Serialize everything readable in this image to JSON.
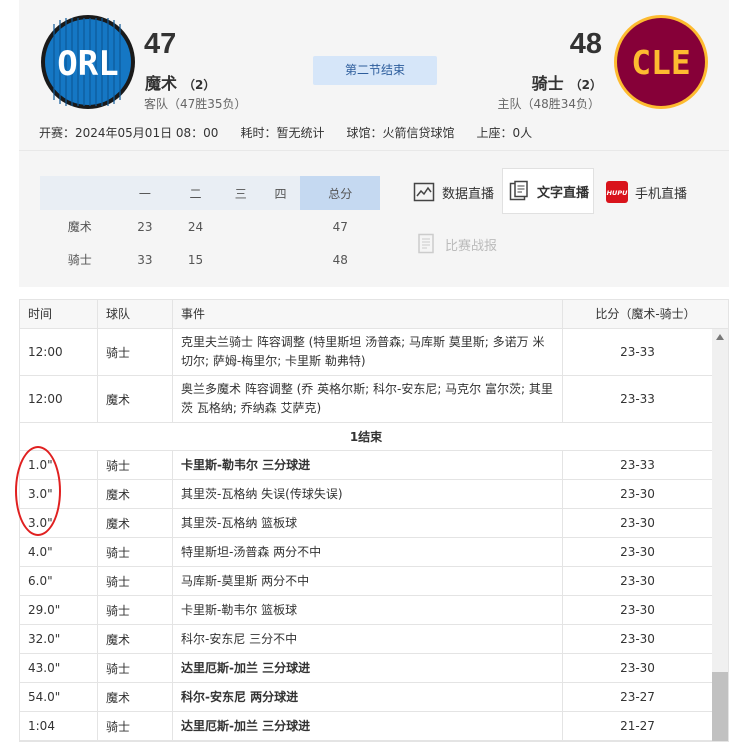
{
  "away": {
    "logo_text": "ORL",
    "score": "47",
    "name": "魔术",
    "rank": "（2）",
    "record": "客队（47胜35负）",
    "colors": {
      "primary": "#1577c4",
      "stripe": "#2f6db8",
      "ring": "#1a1a1a"
    }
  },
  "home": {
    "logo_text": "CLE",
    "score": "48",
    "name": "骑士",
    "rank": "（2）",
    "record": "主队（48胜34负）",
    "colors": {
      "primary": "#860038",
      "text": "#fdbb30",
      "ring": "#fdbb30"
    }
  },
  "status": "第二节结束",
  "info": {
    "start": "开赛：2024年05月01日  08：00",
    "duration": "耗时：暂无统计",
    "venue": "球馆：火箭信贷球馆",
    "attendance": "上座：0人"
  },
  "quarters": {
    "headers": [
      "",
      "一",
      "二",
      "三",
      "四",
      "总分"
    ],
    "rows": [
      {
        "team": "魔术",
        "q": [
          "23",
          "24",
          "",
          ""
        ],
        "total": "47"
      },
      {
        "team": "骑士",
        "q": [
          "33",
          "15",
          "",
          ""
        ],
        "total": "48"
      }
    ]
  },
  "live_buttons": {
    "data": "数据直播",
    "text": "文字直播",
    "mobile": "手机直播",
    "report": "比赛战报",
    "hupu_badge": "HUPU"
  },
  "pbp": {
    "headers": {
      "time": "时间",
      "team": "球队",
      "event": "事件",
      "score": "比分（魔术-骑士）"
    },
    "separator": "1结束",
    "rows_before": [
      {
        "time": "12:00",
        "team": "骑士",
        "event": "克里夫兰骑士 阵容调整 (特里斯坦 汤普森; 马库斯 莫里斯; 多诺万 米切尔; 萨姆-梅里尔; 卡里斯 勒弗特)",
        "score": "23-33",
        "bold": false
      },
      {
        "time": "12:00",
        "team": "魔术",
        "event": "奥兰多魔术 阵容调整 (乔 英格尔斯; 科尔-安东尼; 马克尔 富尔茨; 其里茨 瓦格纳; 乔纳森 艾萨克)",
        "score": "23-33",
        "bold": false
      }
    ],
    "rows_after": [
      {
        "time": "1.0\"",
        "team": "骑士",
        "event": "卡里斯-勒韦尔 三分球进",
        "score": "23-33",
        "bold": true
      },
      {
        "time": "3.0\"",
        "team": "魔术",
        "event": "其里茨-瓦格纳 失误(传球失误)",
        "score": "23-30",
        "bold": false
      },
      {
        "time": "3.0\"",
        "team": "魔术",
        "event": "其里茨-瓦格纳 篮板球",
        "score": "23-30",
        "bold": false
      },
      {
        "time": "4.0\"",
        "team": "骑士",
        "event": "特里斯坦-汤普森 两分不中",
        "score": "23-30",
        "bold": false
      },
      {
        "time": "6.0\"",
        "team": "骑士",
        "event": "马库斯-莫里斯 两分不中",
        "score": "23-30",
        "bold": false
      },
      {
        "time": "29.0\"",
        "team": "骑士",
        "event": "卡里斯-勒韦尔 篮板球",
        "score": "23-30",
        "bold": false
      },
      {
        "time": "32.0\"",
        "team": "魔术",
        "event": "科尔-安东尼 三分不中",
        "score": "23-30",
        "bold": false
      },
      {
        "time": "43.0\"",
        "team": "骑士",
        "event": "达里厄斯-加兰 三分球进",
        "score": "23-30",
        "bold": true
      },
      {
        "time": "54.0\"",
        "team": "魔术",
        "event": "科尔-安东尼 两分球进",
        "score": "23-27",
        "bold": true
      },
      {
        "time": "1:04",
        "team": "骑士",
        "event": "达里厄斯-加兰 三分球进",
        "score": "21-27",
        "bold": true
      }
    ]
  }
}
